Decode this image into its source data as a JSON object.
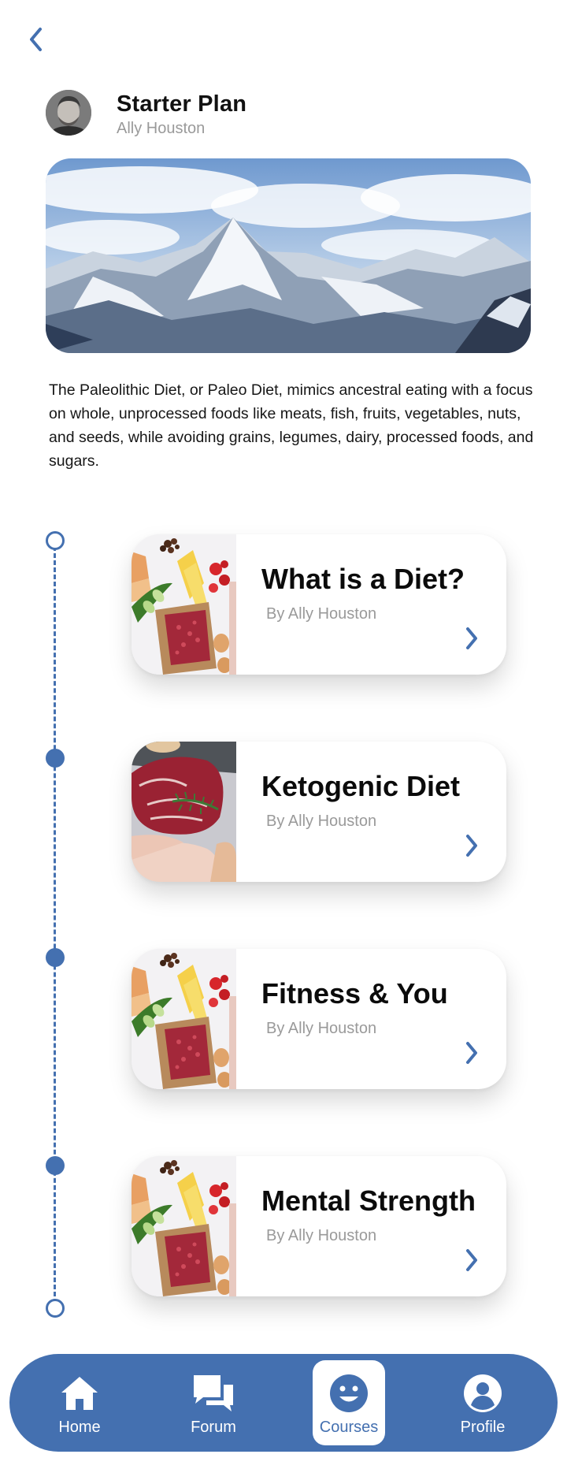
{
  "header": {
    "title": "Starter Plan",
    "author": "Ally Houston"
  },
  "description": "The Paleolithic Diet, or Paleo Diet, mimics ancestral eating with a focus on whole, unprocessed foods like meats, fish, fruits, vegetables, nuts, and seeds, while avoiding grains, legumes, dairy, processed foods, and sugars.",
  "timeline": {
    "nodes": [
      "start",
      "course-2",
      "course-3",
      "course-4",
      "end"
    ]
  },
  "courses": [
    {
      "title": "What is a Diet?",
      "author": "By Ally Houston"
    },
    {
      "title": "Ketogenic Diet",
      "author": "By Ally Houston"
    },
    {
      "title": "Fitness & You",
      "author": "By Ally Houston"
    },
    {
      "title": "Mental Strength",
      "author": "By Ally Houston"
    }
  ],
  "nav": {
    "items": [
      {
        "label": "Home",
        "icon": "home-icon"
      },
      {
        "label": "Forum",
        "icon": "chat-icon"
      },
      {
        "label": "Courses",
        "icon": "smiley-icon"
      },
      {
        "label": "Profile",
        "icon": "user-icon"
      }
    ],
    "active": "Courses"
  },
  "colors": {
    "accent": "#4470b0",
    "muted_text": "#9a9a9a",
    "background": "#ffffff"
  }
}
